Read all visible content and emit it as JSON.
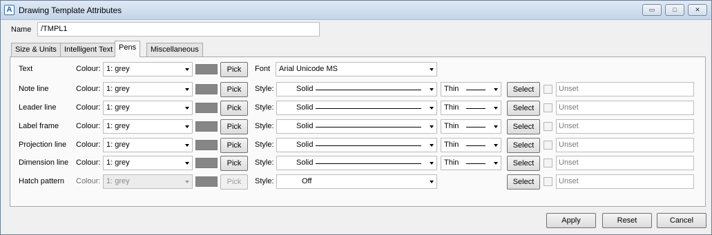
{
  "window": {
    "title": "Drawing Template Attributes",
    "app_icon": "A",
    "controls": {
      "minimize": "▭",
      "maximize": "□",
      "close": "✕"
    }
  },
  "name": {
    "label": "Name",
    "value": "/TMPL1"
  },
  "tabs": [
    {
      "label": "Size & Units",
      "active": false
    },
    {
      "label": "Intelligent Text",
      "active": false
    },
    {
      "label": "Pens",
      "active": true
    },
    {
      "label": "Miscellaneous",
      "active": false
    }
  ],
  "pens": {
    "colour_label": "Colour:",
    "pick_label": "Pick",
    "font_label": "Font",
    "style_label": "Style:",
    "select_label": "Select",
    "swatch_color": "#868686",
    "text": {
      "label": "Text",
      "colour": "1: grey",
      "font": "Arial Unicode MS"
    },
    "rows": [
      {
        "label": "Note line",
        "colour": "1: grey",
        "style": "Solid",
        "thickness": "Thin",
        "value": "Unset"
      },
      {
        "label": "Leader line",
        "colour": "1: grey",
        "style": "Solid",
        "thickness": "Thin",
        "value": "Unset"
      },
      {
        "label": "Label frame",
        "colour": "1: grey",
        "style": "Solid",
        "thickness": "Thin",
        "value": "Unset"
      },
      {
        "label": "Projection line",
        "colour": "1: grey",
        "style": "Solid",
        "thickness": "Thin",
        "value": "Unset"
      },
      {
        "label": "Dimension line",
        "colour": "1: grey",
        "style": "Solid",
        "thickness": "Thin",
        "value": "Unset"
      }
    ],
    "hatch": {
      "label": "Hatch pattern",
      "colour": "1: grey",
      "style": "Off",
      "value": "Unset"
    }
  },
  "buttons": {
    "apply": "Apply",
    "reset": "Reset",
    "cancel": "Cancel"
  }
}
